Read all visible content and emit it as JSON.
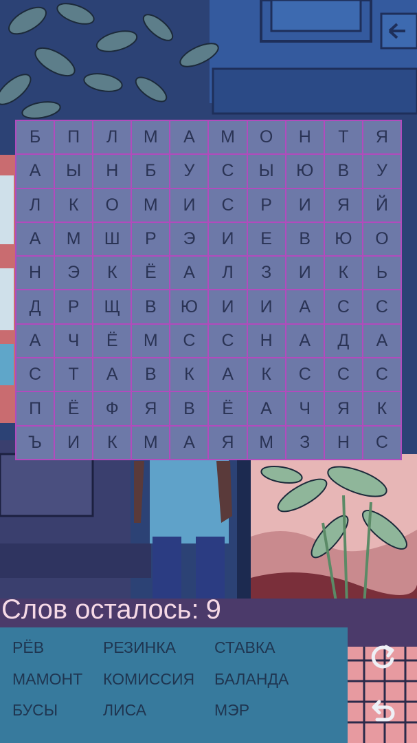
{
  "grid": {
    "rows": [
      [
        "Б",
        "П",
        "Л",
        "М",
        "А",
        "М",
        "О",
        "Н",
        "Т",
        "Я"
      ],
      [
        "А",
        "Ы",
        "Н",
        "Б",
        "У",
        "С",
        "Ы",
        "Ю",
        "В",
        "У"
      ],
      [
        "Л",
        "К",
        "О",
        "М",
        "И",
        "С",
        "Р",
        "И",
        "Я",
        "Й"
      ],
      [
        "А",
        "М",
        "Ш",
        "Р",
        "Э",
        "И",
        "Е",
        "В",
        "Ю",
        "О"
      ],
      [
        "Н",
        "Э",
        "К",
        "Ё",
        "А",
        "Л",
        "З",
        "И",
        "К",
        "Ь"
      ],
      [
        "Д",
        "Р",
        "Щ",
        "В",
        "Ю",
        "И",
        "И",
        "А",
        "С",
        "С"
      ],
      [
        "А",
        "Ч",
        "Ё",
        "М",
        "С",
        "С",
        "Н",
        "А",
        "Д",
        "А"
      ],
      [
        "С",
        "Т",
        "А",
        "В",
        "К",
        "А",
        "К",
        "С",
        "С",
        "С"
      ],
      [
        "П",
        "Ё",
        "Ф",
        "Я",
        "В",
        "Ё",
        "А",
        "Ч",
        "Я",
        "К"
      ],
      [
        "Ъ",
        "И",
        "К",
        "М",
        "А",
        "Я",
        "М",
        "З",
        "Н",
        "С"
      ]
    ]
  },
  "counter": {
    "label": "Слов осталось:",
    "value": "9"
  },
  "words": [
    "РЁВ",
    "РЕЗИНКА",
    "СТАВКА",
    "МАМОНТ",
    "КОМИССИЯ",
    "БАЛАНДА",
    "БУСЫ",
    "ЛИСА",
    "МЭР"
  ],
  "buttons": {
    "refresh_icon": "refresh-icon",
    "undo_icon": "undo-icon"
  },
  "colors": {
    "cell": "#6d79a8",
    "grid_lines": "#b24bbd",
    "panel": "#377a9d",
    "counter_text": "#f6d9e6"
  }
}
